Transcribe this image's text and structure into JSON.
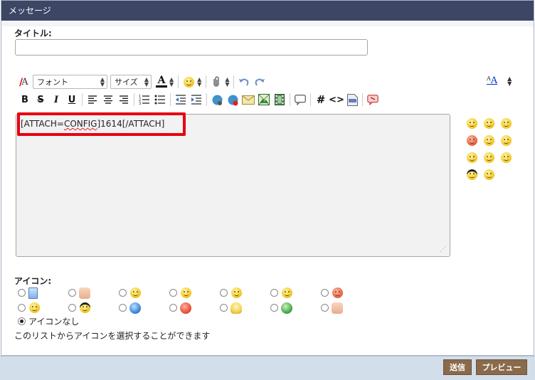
{
  "window": {
    "title": "メッセージ"
  },
  "title_field": {
    "label": "タイトル:",
    "value": ""
  },
  "toolbar": {
    "font_select": "フォント",
    "size_select": "サイズ",
    "bold": "B",
    "strike": "S",
    "italic": "I",
    "underline": "U",
    "hash": "#",
    "code": "<>",
    "text_color_glyph": "A",
    "remove_format_glyph": "A",
    "text_size_glyph": "A",
    "text_size_small": "A"
  },
  "editor": {
    "content_before": "[ATTACH=",
    "content_misspelled": "CONFIG",
    "content_after": "]1614[/ATTACH]",
    "resize_grip": "⋰"
  },
  "icons_section": {
    "label": "アイコン:",
    "row1": [
      "doc",
      "thumbs-down",
      "smile-grin",
      "smile",
      "smile-blush",
      "smile-neutral",
      "angry"
    ],
    "row2": [
      "smile-yellow",
      "cool",
      "question",
      "exclamation",
      "bulb",
      "recycle",
      "thumbs-up"
    ],
    "no_icon_label": "アイコンなし",
    "hint": "このリストからアイコンを選択することができます"
  },
  "buttons": {
    "send": "送信",
    "preview": "プレビュー"
  },
  "colors": {
    "titlebar": "#3d4664",
    "footer": "#d3deeb",
    "button": "#8a6a4a",
    "highlight": "#e60012"
  }
}
